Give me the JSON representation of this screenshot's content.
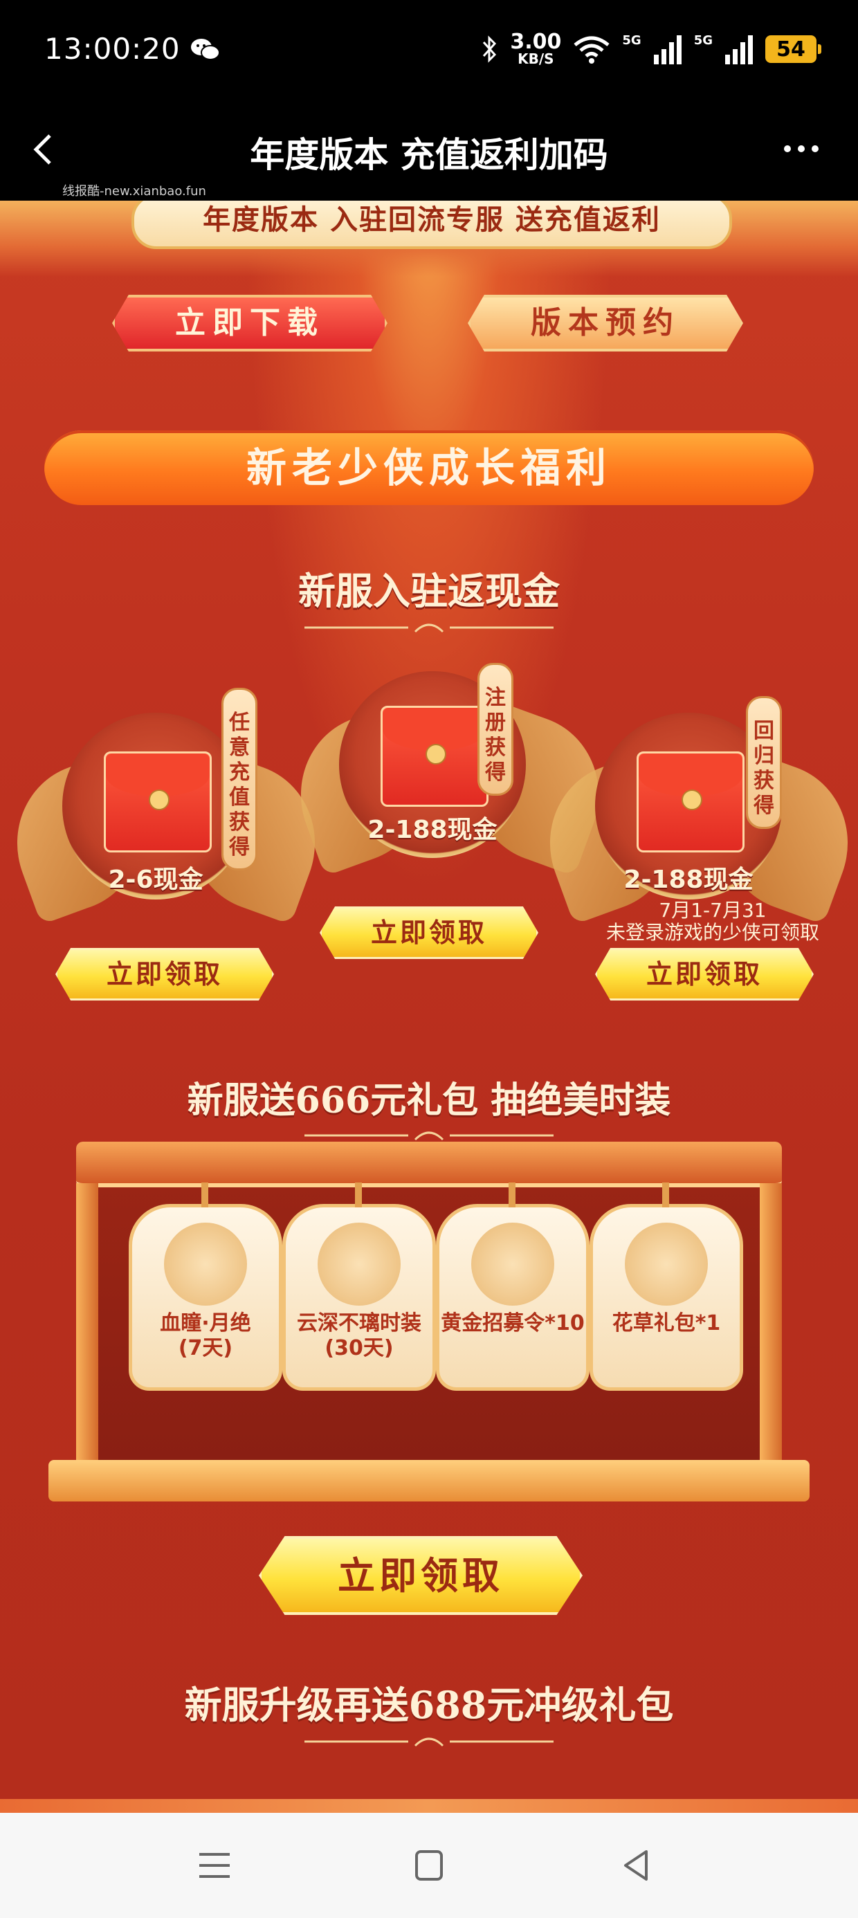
{
  "status_bar": {
    "time": "13:00:20",
    "net_speed_value": "3.00",
    "net_speed_unit": "KB/S",
    "sim1": "5G",
    "sim2": "5G",
    "battery": "54",
    "icons": [
      "wechat-icon",
      "bluetooth-icon",
      "wifi-icon",
      "signal-icon",
      "battery-icon"
    ]
  },
  "titlebar": {
    "title": "年度版本 充值返利加码",
    "watermark": "线报酷-new.xianbao.fun"
  },
  "hero": {
    "banner": "年度版本 入驻回流专服 送充值返利",
    "download_label": "立即下载",
    "reserve_label": "版本预约"
  },
  "section": {
    "title": "新老少侠成长福利"
  },
  "cashback": {
    "heading": "新服入驻返现金",
    "cards": [
      {
        "amount": "2-6现金",
        "tag": "任意充值获得",
        "button": "立即领取"
      },
      {
        "amount": "2-188现金",
        "tag": "注册获得",
        "button": "立即领取"
      },
      {
        "amount": "2-188现金",
        "tag": "回归获得",
        "button": "立即领取",
        "note_line1": "7月1-7月31",
        "note_line2": "未登录游戏的少侠可领取"
      }
    ]
  },
  "gifts": {
    "heading": "新服送666元礼包  抽绝美时装",
    "items": [
      {
        "name_line1": "血瞳·月绝",
        "name_line2": "(7天)"
      },
      {
        "name_line1": "云深不璃时装",
        "name_line2": "(30天)"
      },
      {
        "name_line1": "黄金招募令*10",
        "name_line2": ""
      },
      {
        "name_line1": "花草礼包*1",
        "name_line2": ""
      }
    ],
    "claim_button": "立即领取"
  },
  "levelup": {
    "heading": "新服升级再送688元冲级礼包"
  },
  "colors": {
    "background": "#bf3220",
    "accent_orange": "#ff7a1e",
    "claim_yellow": "#ffe23c",
    "text_cream": "#fff1d6"
  }
}
